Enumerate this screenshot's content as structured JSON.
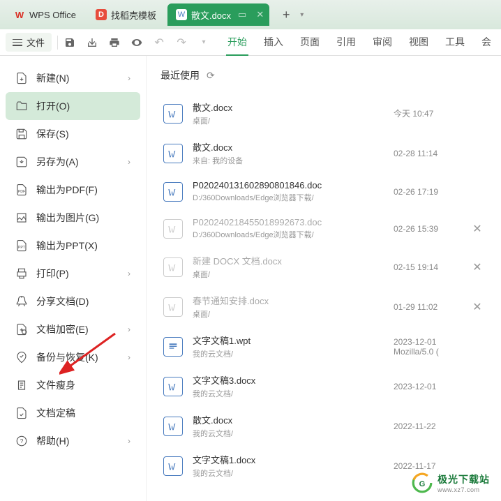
{
  "tabs": {
    "app": "WPS Office",
    "template": "找稻壳模板",
    "doc": "散文.docx"
  },
  "file_menu": "文件",
  "ribbon": [
    "开始",
    "插入",
    "页面",
    "引用",
    "审阅",
    "视图",
    "工具",
    "会"
  ],
  "ribbon_active": 0,
  "sidebar": [
    {
      "label": "新建(N)",
      "chevron": true
    },
    {
      "label": "打开(O)",
      "active": true
    },
    {
      "label": "保存(S)"
    },
    {
      "label": "另存为(A)",
      "chevron": true
    },
    {
      "label": "输出为PDF(F)"
    },
    {
      "label": "输出为图片(G)"
    },
    {
      "label": "输出为PPT(X)"
    },
    {
      "label": "打印(P)",
      "chevron": true
    },
    {
      "label": "分享文档(D)"
    },
    {
      "label": "文档加密(E)",
      "chevron": true
    },
    {
      "label": "备份与恢复(K)",
      "chevron": true
    },
    {
      "label": "文件瘦身"
    },
    {
      "label": "文档定稿"
    },
    {
      "label": "帮助(H)",
      "chevron": true
    }
  ],
  "content_title": "最近使用",
  "files": [
    {
      "name": "散文.docx",
      "path": "桌面/",
      "time": "今天 10:47",
      "type": "docx"
    },
    {
      "name": "散文.docx",
      "path": "来自: 我的设备",
      "time": "02-28 11:14",
      "type": "docx"
    },
    {
      "name": "P020240131602890801846.doc",
      "path": "D:/360Downloads/Edge浏览器下载/",
      "time": "02-26 17:19",
      "type": "docx"
    },
    {
      "name": "P020240218455018992673.doc",
      "path": "D:/360Downloads/Edge浏览器下载/",
      "time": "02-26 15:39",
      "type": "faded",
      "close": true
    },
    {
      "name": "新建 DOCX 文档.docx",
      "path": "桌面/",
      "time": "02-15 19:14",
      "type": "faded",
      "close": true
    },
    {
      "name": "春节通知安排.docx",
      "path": "桌面/",
      "time": "01-29 11:02",
      "type": "faded",
      "close": true
    },
    {
      "name": "文字文稿1.wpt",
      "path": "我的云文档/",
      "time": "2023-12-01\nMozilla/5.0 (",
      "type": "wpt"
    },
    {
      "name": "文字文稿3.docx",
      "path": "我的云文档/",
      "time": "2023-12-01",
      "type": "docx"
    },
    {
      "name": "散文.docx",
      "path": "我的云文档/",
      "time": "2022-11-22",
      "type": "docx"
    },
    {
      "name": "文字文稿1.docx",
      "path": "我的云文档/",
      "time": "2022-11-17",
      "type": "docx"
    }
  ],
  "watermark": {
    "title": "极光下载站",
    "url": "www.xz7.com"
  }
}
